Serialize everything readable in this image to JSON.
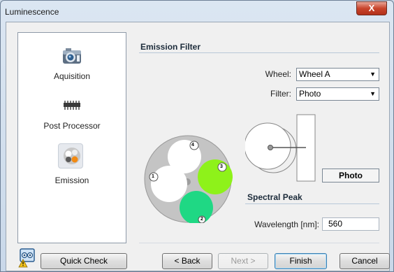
{
  "window": {
    "title": "Luminescence",
    "close_glyph": "X"
  },
  "nav": {
    "items": [
      {
        "label": "Aquisition",
        "icon": "camera-icon"
      },
      {
        "label": "Post Processor",
        "icon": "chip-icon"
      },
      {
        "label": "Emission",
        "icon": "filter-wheel-icon",
        "selected": true
      }
    ]
  },
  "emission_filter": {
    "section_title": "Emission Filter",
    "wheel_label": "Wheel:",
    "wheel_value": "Wheel A",
    "filter_label": "Filter:",
    "filter_value": "Photo",
    "slot_numbers": [
      "1",
      "2",
      "3",
      "4"
    ],
    "slot_colors": [
      "#ffffff",
      "#1fd884",
      "#8ef21a",
      "#ffffff"
    ],
    "selected_filter_button": "Photo"
  },
  "spectral_peak": {
    "section_title": "Spectral Peak",
    "wavelength_label": "Wavelength [nm]:",
    "wavelength_value": "560"
  },
  "footer": {
    "quick_check": "Quick Check",
    "back": "< Back",
    "next": "Next >",
    "finish": "Finish",
    "cancel": "Cancel"
  }
}
